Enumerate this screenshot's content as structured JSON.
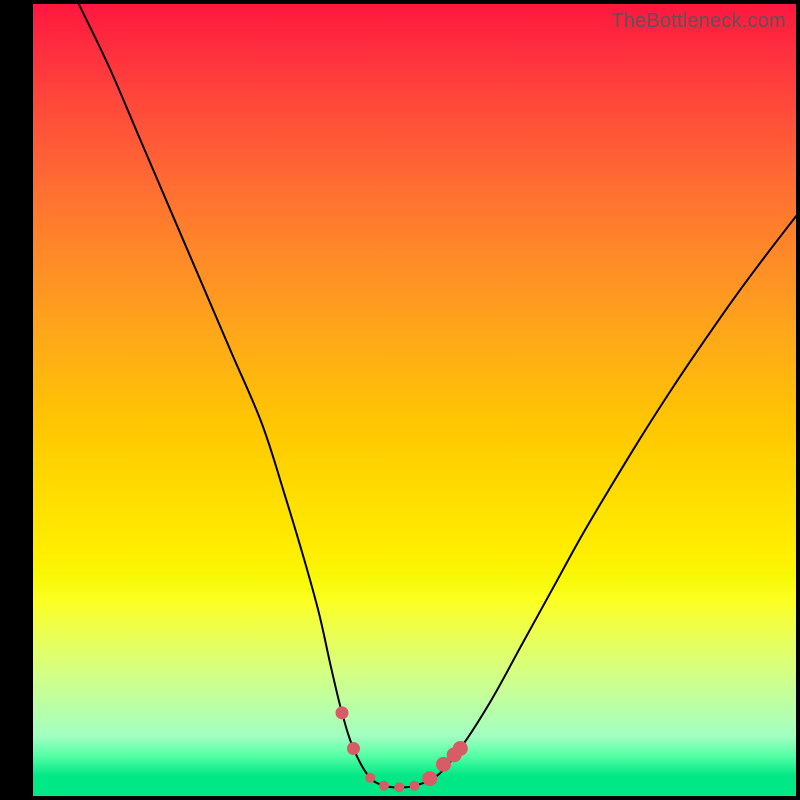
{
  "watermark": "TheBottleneck.com",
  "colors": {
    "curve": "#000000",
    "marker_fill": "#d85b66",
    "marker_stroke": "#d85b66",
    "frame": "#000000"
  },
  "chart_data": {
    "type": "line",
    "title": "",
    "xlabel": "",
    "ylabel": "",
    "xlim": [
      0,
      100
    ],
    "ylim": [
      0,
      100
    ],
    "grid": false,
    "legend": false,
    "series": [
      {
        "name": "bottleneck-curve",
        "x": [
          6,
          10,
          14,
          18,
          22,
          26,
          30,
          33,
          35.5,
          37.5,
          39,
          40.5,
          42,
          44,
          46,
          48,
          50,
          53,
          56,
          60,
          64,
          68,
          72,
          76,
          80,
          84,
          88,
          92,
          96,
          100
        ],
        "y": [
          100,
          92,
          83,
          74,
          65,
          56,
          47,
          38,
          30,
          23,
          16.5,
          10.5,
          6,
          2.5,
          1.3,
          1.1,
          1.3,
          2.6,
          6,
          12,
          19,
          26,
          33,
          39.5,
          45.8,
          51.8,
          57.5,
          63,
          68.2,
          73.2
        ]
      }
    ],
    "markers": {
      "name": "highlight-dots",
      "x": [
        40.5,
        42,
        44.2,
        46,
        48,
        50,
        52,
        53.8,
        55.2,
        56.0
      ],
      "y": [
        10.5,
        6.0,
        2.3,
        1.3,
        1.1,
        1.3,
        2.2,
        4.0,
        5.2,
        6.0
      ],
      "r": [
        6.5,
        6.5,
        5.0,
        5.0,
        5.0,
        5.0,
        7.5,
        7.5,
        7.5,
        7.5
      ]
    },
    "gradient_stops": [
      {
        "pct": 0,
        "color": "#ff173f"
      },
      {
        "pct": 50,
        "color": "#ffbe07"
      },
      {
        "pct": 75,
        "color": "#fcff1e"
      },
      {
        "pct": 95,
        "color": "#52ffa5"
      },
      {
        "pct": 100,
        "color": "#00e785"
      }
    ]
  }
}
